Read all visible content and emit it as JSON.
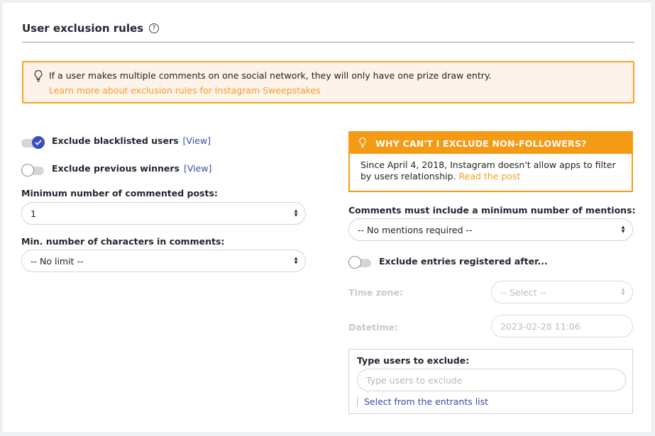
{
  "section": {
    "title": "User exclusion rules",
    "help_symbol": "?"
  },
  "info": {
    "text": "If a user makes multiple comments on one social network, they will only have one prize draw entry.",
    "link": "Learn more about exclusion rules for Instagram Sweepstakes"
  },
  "left": {
    "blacklist": {
      "label": "Exclude blacklisted users",
      "view": "[View]",
      "enabled": true
    },
    "previous_winners": {
      "label": "Exclude previous winners",
      "view": "[View]",
      "enabled": false
    },
    "min_posts": {
      "label": "Minimum number of commented posts:",
      "value": "1"
    },
    "min_chars": {
      "label": "Min. number of characters in comments:",
      "value": "-- No limit --"
    }
  },
  "warning": {
    "title": "WHY CAN'T I EXCLUDE NON-FOLLOWERS?",
    "body": "Since April 4, 2018, Instagram doesn't allow apps to filter by users relationship.",
    "link": "Read the post"
  },
  "right": {
    "mentions": {
      "label": "Comments must include a minimum number of mentions:",
      "value": "-- No mentions required --"
    },
    "registered_after": {
      "label": "Exclude entries registered after...",
      "enabled": false
    },
    "timezone": {
      "label": "Time zone:",
      "value": "-- Select --"
    },
    "datetime": {
      "label": "Datetime:",
      "value": "2023-02-28 11:06"
    },
    "exclude_users": {
      "title": "Type users to exclude:",
      "placeholder": "Type users to exclude",
      "link": "Select from the entrants list"
    }
  },
  "colors": {
    "accent_orange": "#f59a14",
    "accent_blue": "#3c4ec4",
    "link_blue": "#3848a8"
  }
}
